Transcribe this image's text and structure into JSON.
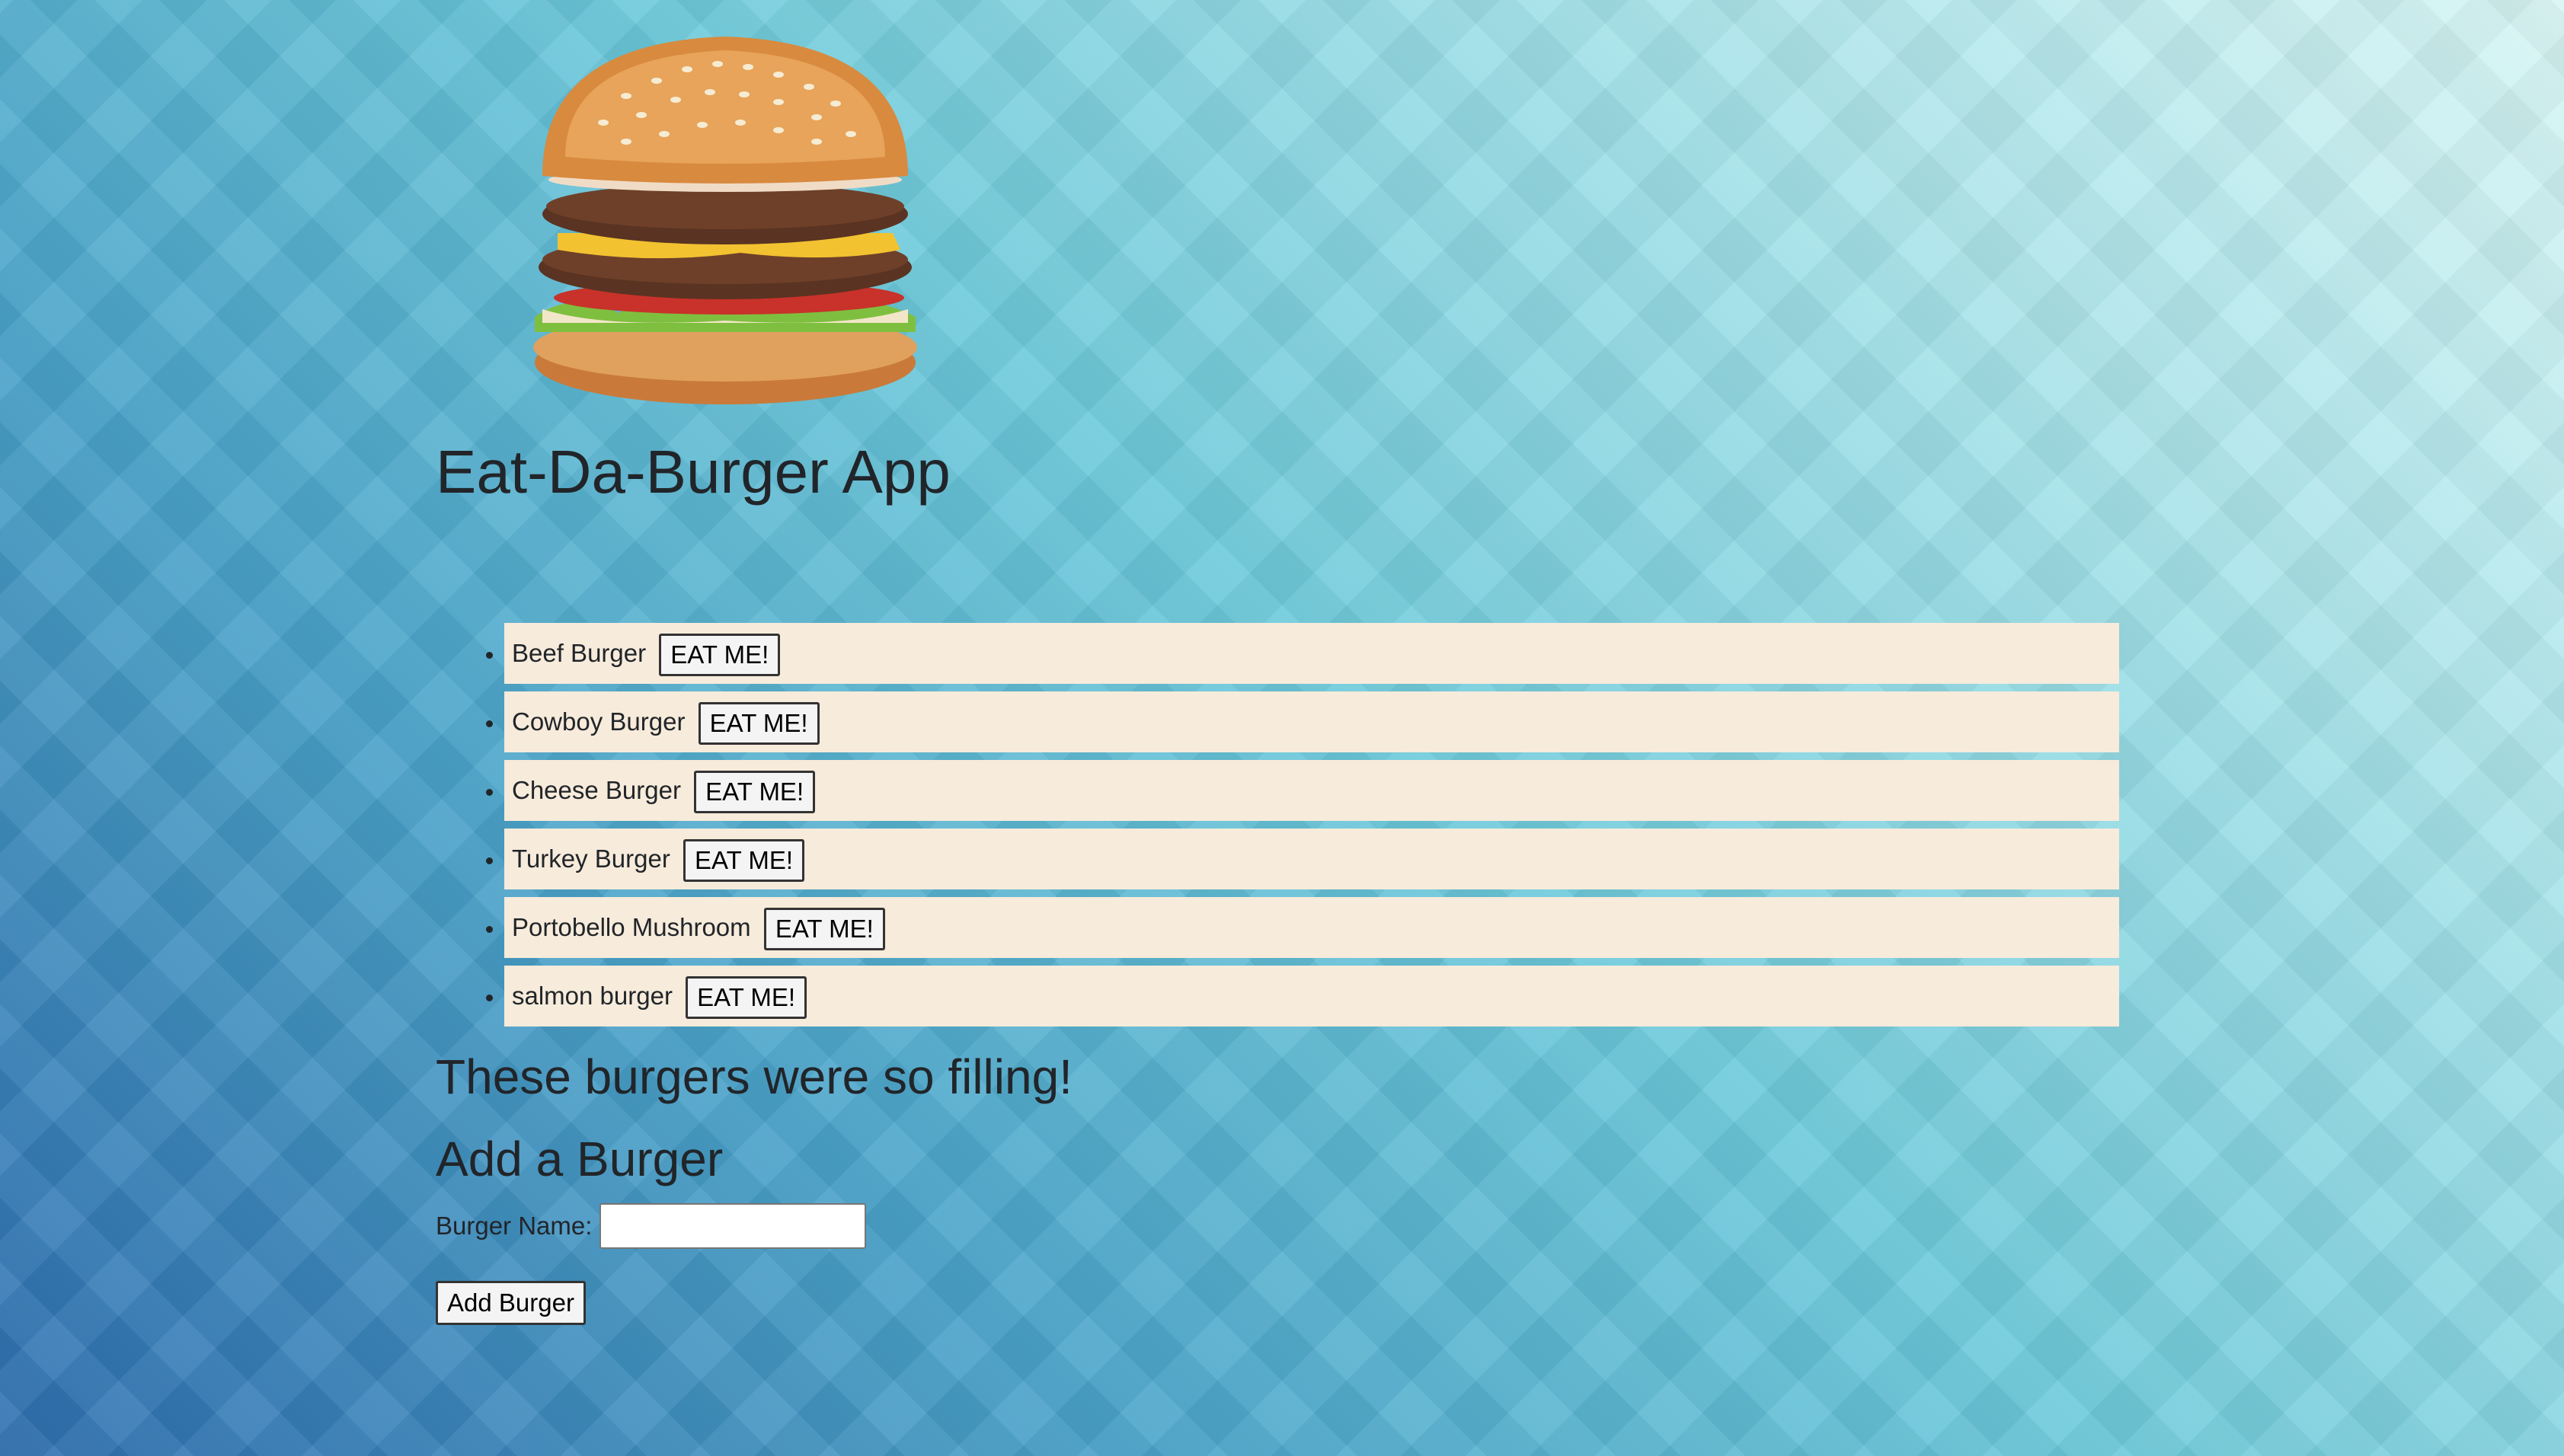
{
  "header": {
    "logo_icon": "hamburger-image",
    "title": "Eat-Da-Burger App"
  },
  "burgers": [
    {
      "name": "Beef Burger",
      "button_label": "EAT ME!"
    },
    {
      "name": "Cowboy Burger",
      "button_label": "EAT ME!"
    },
    {
      "name": "Cheese Burger",
      "button_label": "EAT ME!"
    },
    {
      "name": "Turkey Burger",
      "button_label": "EAT ME!"
    },
    {
      "name": "Portobello Mushroom",
      "button_label": "EAT ME!"
    },
    {
      "name": "salmon burger",
      "button_label": "EAT ME!"
    }
  ],
  "devoured": {
    "heading": "These burgers were so filling!"
  },
  "add_form": {
    "heading": "Add a Burger",
    "field_label": "Burger Name:",
    "field_value": "",
    "field_placeholder": "",
    "submit_label": "Add Burger"
  },
  "colors": {
    "list_item_bg": "#f7ebdb",
    "background_dark": "#2f6fb0",
    "background_light": "#d8f5f4"
  }
}
